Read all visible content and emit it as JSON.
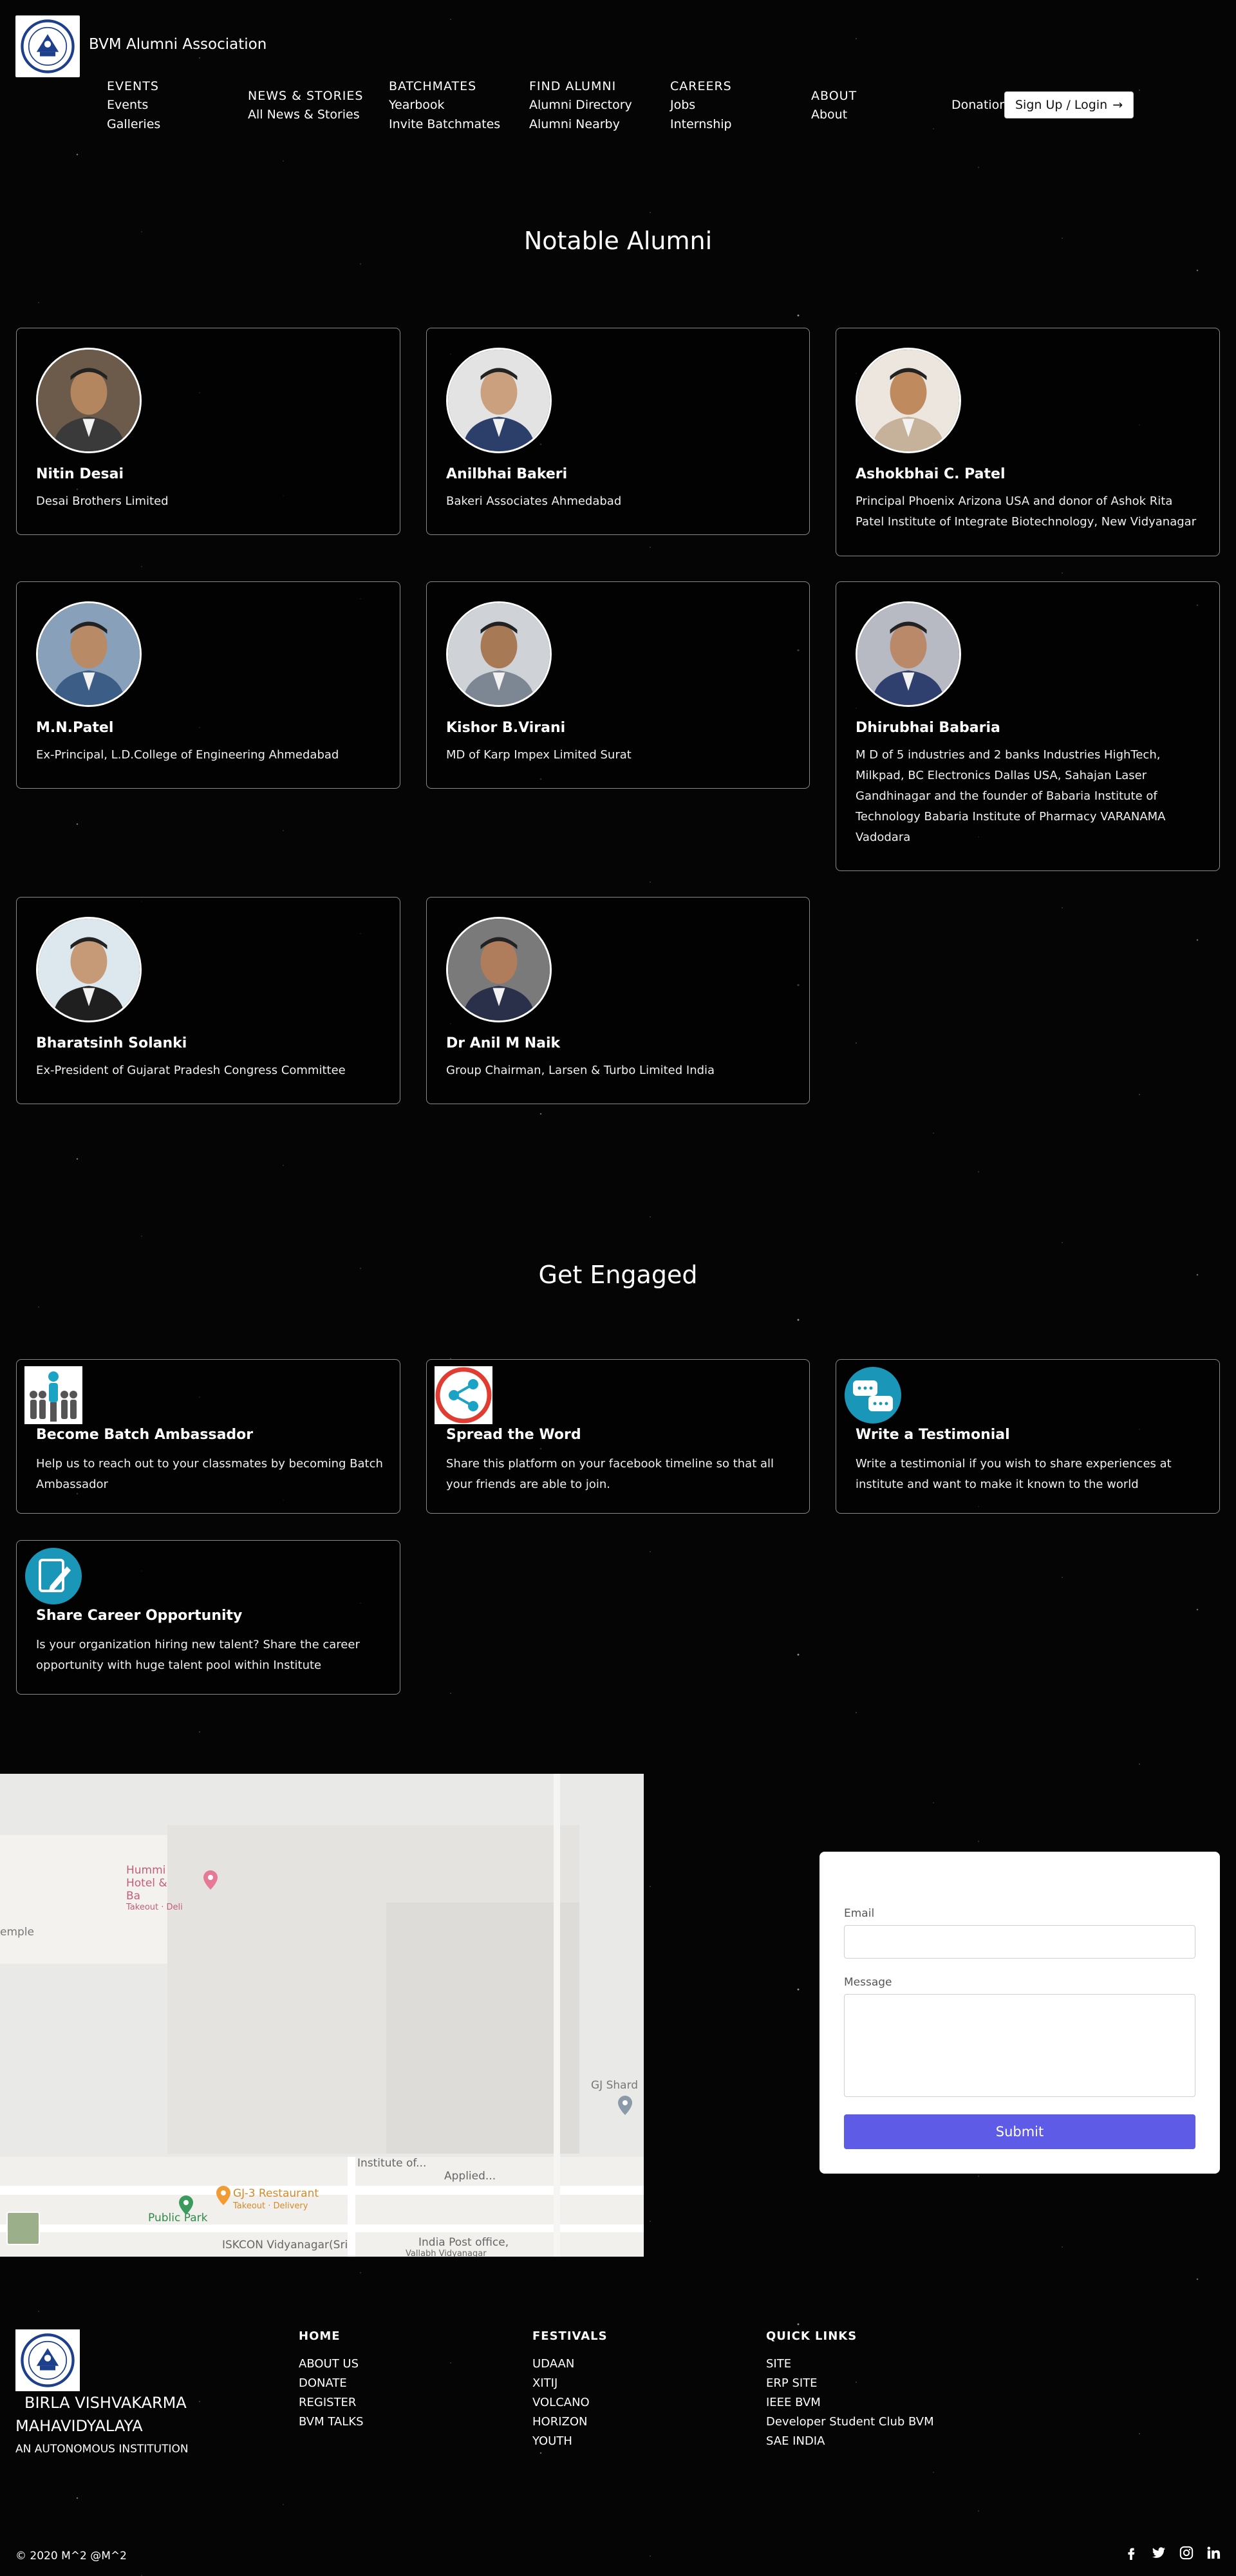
{
  "header": {
    "brand": "BVM Alumni Association",
    "nav": [
      {
        "head": "EVENTS",
        "links": [
          "Events",
          "Galleries"
        ]
      },
      {
        "head": "NEWS & STORIES",
        "links": [
          "All News & Stories"
        ]
      },
      {
        "head": "BATCHMATES",
        "links": [
          "Yearbook",
          "Invite Batchmates"
        ]
      },
      {
        "head": "FIND ALUMNI",
        "links": [
          "Alumni Directory",
          "Alumni Nearby"
        ]
      },
      {
        "head": "CAREERS",
        "links": [
          "Jobs",
          "Internship"
        ]
      },
      {
        "head": "ABOUT",
        "links": [
          "About"
        ]
      }
    ],
    "donation": "Donation",
    "signup": "Sign Up / Login",
    "signup_arrow": "→"
  },
  "notable": {
    "title": "Notable Alumni",
    "alumni": [
      {
        "name": "Nitin Desai",
        "desc": "Desai Brothers Limited"
      },
      {
        "name": "Anilbhai Bakeri",
        "desc": "Bakeri Associates Ahmedabad"
      },
      {
        "name": "Ashokbhai C. Patel",
        "desc": "Principal Phoenix Arizona USA and donor of Ashok Rita Patel Institute of Integrate Biotechnology, New Vidyanagar"
      },
      {
        "name": "M.N.Patel",
        "desc": "Ex-Principal, L.D.College of Engineering Ahmedabad"
      },
      {
        "name": "Kishor B.Virani",
        "desc": "MD of Karp Impex Limited Surat"
      },
      {
        "name": "Dhirubhai Babaria",
        "desc": "M D of 5 industries and 2 banks Industries HighTech, Milkpad, BC Electronics Dallas USA, Sahajan Laser Gandhinagar and the founder of Babaria Institute of Technology Babaria Institute of Pharmacy VARANAMA Vadodara"
      },
      {
        "name": "Bharatsinh Solanki",
        "desc": "Ex-President of Gujarat Pradesh Congress Committee"
      },
      {
        "name": "Dr Anil M Naik",
        "desc": "Group Chairman, Larsen & Turbo Limited India"
      }
    ]
  },
  "engage": {
    "title": "Get Engaged",
    "items": [
      {
        "title": "Become Batch Ambassador",
        "desc": "Help us to reach out to your classmates by becoming Batch Ambassador",
        "icon": "ambassador-icon"
      },
      {
        "title": "Spread the Word",
        "desc": "Share this platform on your facebook timeline so that all your friends are able to join.",
        "icon": "share-icon"
      },
      {
        "title": "Write a Testimonial",
        "desc": "Write a testimonial if you wish to share experiences at institute and want to make it known to the world",
        "icon": "testimonial-icon"
      },
      {
        "title": "Share Career Opportunity",
        "desc": "Is your organization hiring new talent? Share the career opportunity with huge talent pool within Institute",
        "icon": "career-icon"
      }
    ]
  },
  "map": {
    "labels": {
      "hotel": "Hummi Hotel & Ba",
      "takeout": "Takeout · Deli",
      "temple": "emple",
      "shard": "GJ Shard",
      "institute": "Institute of...",
      "applied": "Applied...",
      "restaurant": "GJ-3 Restaurant",
      "restaurant_sub": "Takeout · Delivery",
      "park": "Public Park",
      "iskcon": "ISKCON Vidyanagar(Sri",
      "post": "India Post office,",
      "post2": "Vallabh Vidyanagar"
    }
  },
  "contact": {
    "email_label": "Email",
    "message_label": "Message",
    "submit": "Submit"
  },
  "footer": {
    "inst_line1": "BIRLA VISHVAKARMA",
    "inst_line2": "MAHAVIDYALAYA",
    "autonomous": "AN AUTONOMOUS INSTITUTION",
    "cols": [
      {
        "head": "HOME",
        "links": [
          "ABOUT US",
          "DONATE",
          "REGISTER",
          "BVM TALKS"
        ]
      },
      {
        "head": "FESTIVALS",
        "links": [
          "UDAAN",
          "XITIJ",
          "VOLCANO",
          "HORIZON",
          "YOUTH"
        ]
      },
      {
        "head": "QUICK LINKS",
        "links": [
          "SITE",
          "ERP SITE",
          "IEEE BVM",
          "Developer Student Club BVM",
          "SAE INDIA"
        ]
      }
    ],
    "copyright": "© 2020 M^2  @M^2",
    "social": [
      "f",
      "t",
      "ig",
      "in"
    ]
  },
  "colors": {
    "background": "#050505",
    "card_border": "#8a8a8a",
    "submit": "#5e5ce6"
  }
}
